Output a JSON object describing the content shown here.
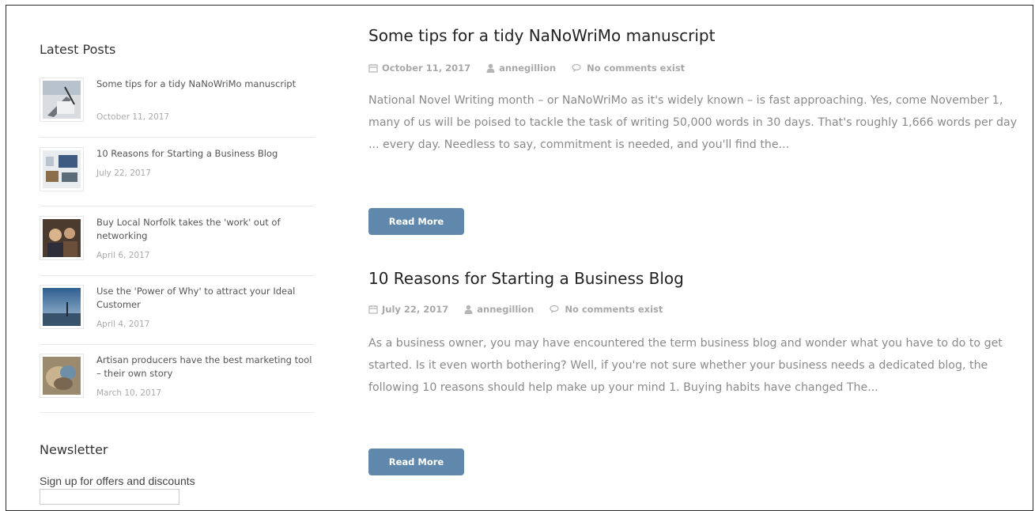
{
  "sidebar": {
    "latest_posts_title": "Latest Posts",
    "posts": [
      {
        "title": "Some tips for a tidy NaNoWriMo manuscript",
        "date": "October 11, 2017"
      },
      {
        "title": "10 Reasons for Starting a Business Blog",
        "date": "July 22, 2017"
      },
      {
        "title": "Buy Local Norfolk takes the 'work' out of networking",
        "date": "April 6, 2017"
      },
      {
        "title": "Use the 'Power of Why' to attract your Ideal Customer",
        "date": "April 4, 2017"
      },
      {
        "title": "Artisan producers have the best marketing tool – their own story",
        "date": "March 10, 2017"
      }
    ],
    "newsletter_title": "Newsletter",
    "newsletter_text": "Sign up for offers and discounts"
  },
  "articles": [
    {
      "title": "Some tips for a tidy NaNoWriMo manuscript",
      "date": "October 11, 2017",
      "author": "annegillion",
      "comments": "No comments exist",
      "excerpt": "National Novel Writing month – or NaNoWriMo as it's widely known – is fast approaching. Yes, come November 1, many of us will be poised to tackle the task of writing 50,000 words in 30 days. That's roughly 1,666 words per day ... every day. Needless to say, commitment is needed, and you'll find the...",
      "read_more": "Read More"
    },
    {
      "title": "10 Reasons for Starting a Business Blog",
      "date": "July 22, 2017",
      "author": "annegillion",
      "comments": "No comments exist",
      "excerpt": "As a business owner, you may have encountered the term business blog and wonder what you have to do to get started. Is it even worth bothering? Well, if you're not sure whether your business needs a dedicated blog, the following 10 reasons should help make up your mind 1. Buying habits have changed The...",
      "read_more": "Read More"
    }
  ],
  "colors": {
    "button": "#5f88ac",
    "meta": "#a8a8a8",
    "excerpt": "#8a8a8a"
  },
  "icons": {
    "date": "calendar-icon",
    "author": "user-icon",
    "comments": "comments-icon"
  }
}
